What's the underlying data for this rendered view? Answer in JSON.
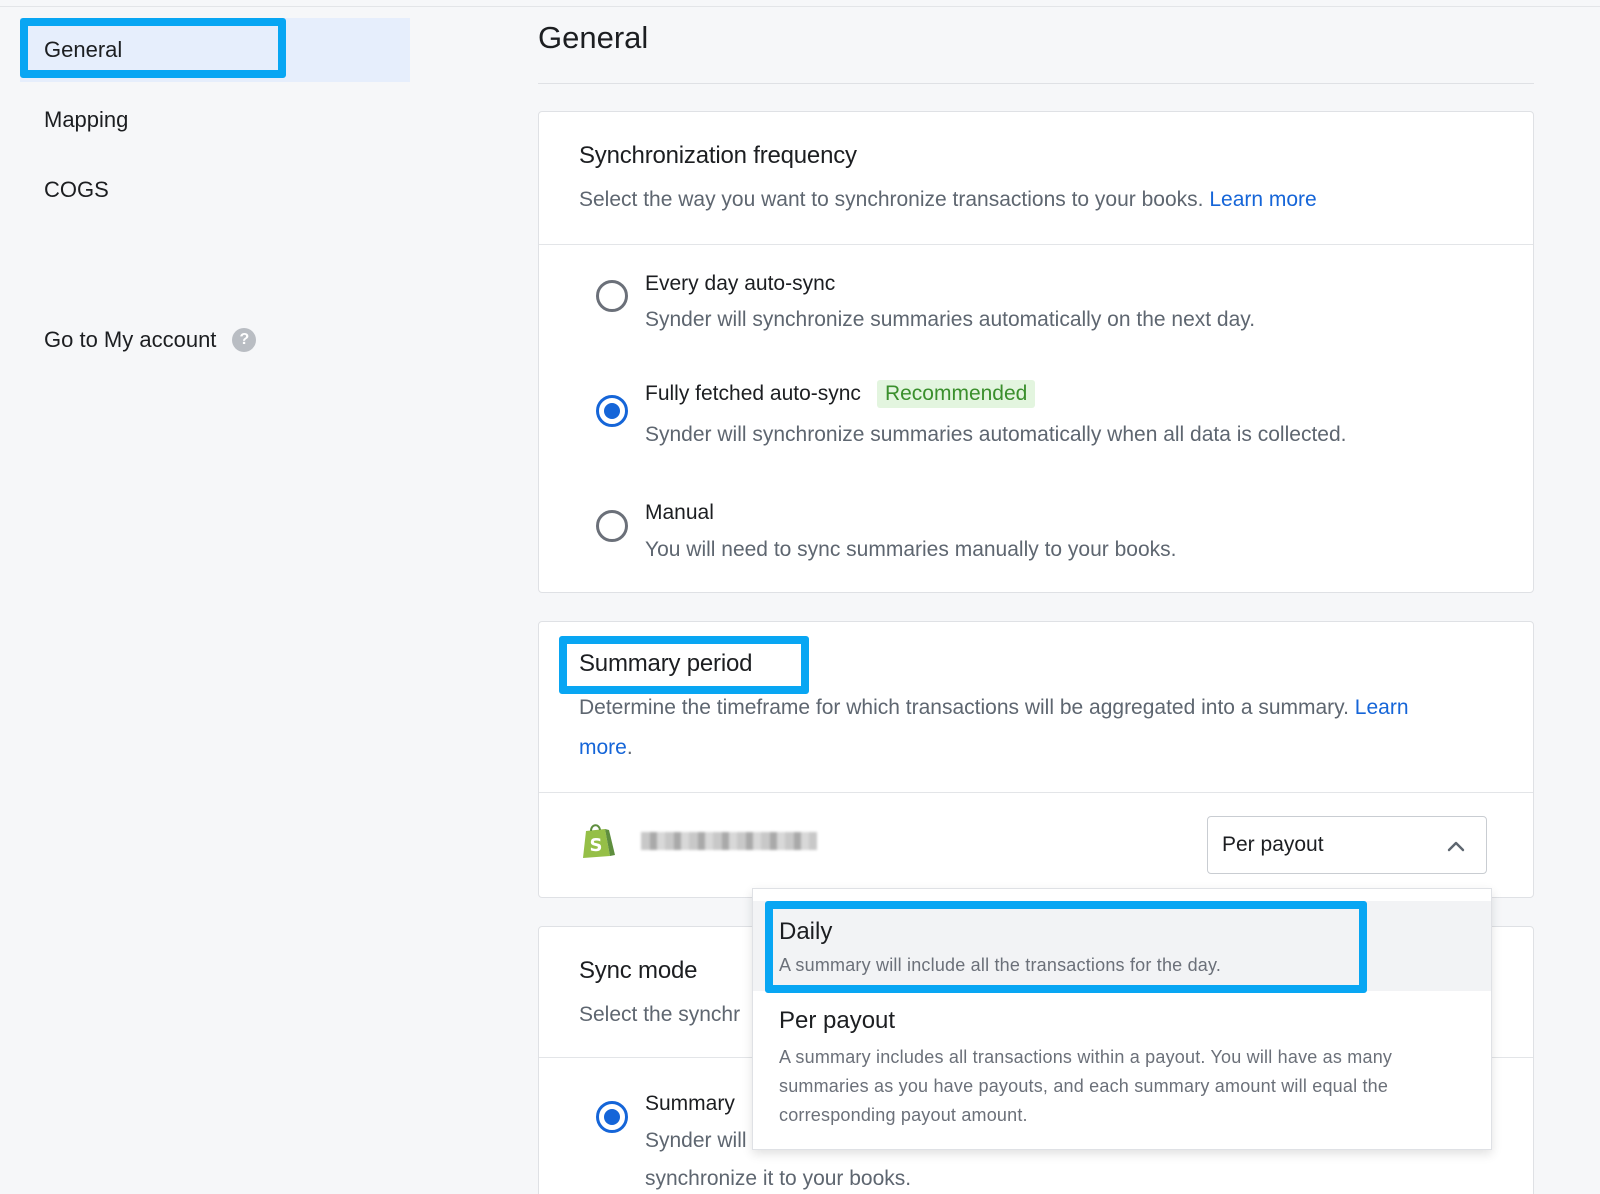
{
  "sidebar": {
    "items": [
      {
        "label": "General"
      },
      {
        "label": "Mapping"
      },
      {
        "label": "COGS"
      }
    ],
    "account_link": "Go to My account",
    "help_glyph": "?"
  },
  "page": {
    "title": "General"
  },
  "sync_frequency": {
    "title": "Synchronization frequency",
    "description": "Select the way you want to synchronize transactions to your books.",
    "learn_more": "Learn more",
    "options": [
      {
        "title": "Every day auto-sync",
        "description": "Synder will synchronize summaries automatically on the next day.",
        "checked": false
      },
      {
        "title": "Fully fetched auto-sync",
        "badge": "Recommended",
        "description": "Synder will synchronize summaries automatically when all data is collected.",
        "checked": true
      },
      {
        "title": "Manual",
        "description": "You will need to sync summaries manually to your books.",
        "checked": false
      }
    ]
  },
  "summary_period": {
    "title": "Summary period",
    "description": "Determine the timeframe for which transactions will be aggregated into a summary.",
    "learn_more_1": "Learn",
    "learn_more_2": "more",
    "period_suffix": ".",
    "integration_icon": "shopify-bag-icon",
    "selected": "Per payout",
    "dropdown_options": [
      {
        "title": "Daily",
        "description": "A summary will include all the transactions for the day."
      },
      {
        "title": "Per payout",
        "description": "A summary includes all transactions within a payout. You will have as many summaries as you have payouts, and each summary amount will equal the corresponding payout amount."
      }
    ]
  },
  "sync_mode": {
    "title": "Sync mode",
    "description": "Select the synchr",
    "option_title": "Summary",
    "option_desc_1": "Synder will",
    "option_desc_2": "synchronize it to your books."
  },
  "colors": {
    "accent": "#1565d8",
    "highlight": "#08a6f3",
    "badge_bg": "#e3f5df",
    "badge_text": "#3a8f2c"
  }
}
